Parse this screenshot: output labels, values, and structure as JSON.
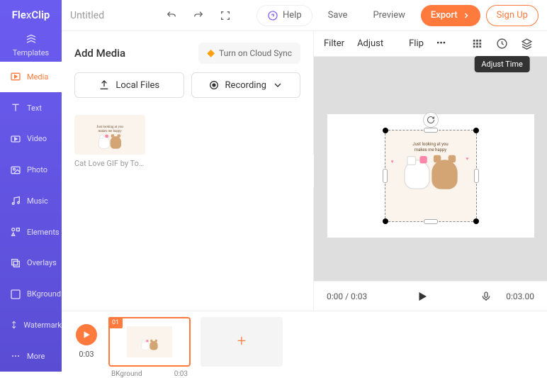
{
  "logo": "FlexClip",
  "sidebar": {
    "items": [
      {
        "label": "Templates"
      },
      {
        "label": "Media"
      },
      {
        "label": "Text"
      },
      {
        "label": "Video"
      },
      {
        "label": "Photo"
      },
      {
        "label": "Music"
      },
      {
        "label": "Elements"
      },
      {
        "label": "Overlays"
      },
      {
        "label": "BKground"
      },
      {
        "label": "Watermark"
      },
      {
        "label": "More"
      }
    ]
  },
  "topbar": {
    "title": "Untitled",
    "help": "Help",
    "save": "Save",
    "preview": "Preview",
    "export": "Export",
    "signup": "Sign Up"
  },
  "panel": {
    "title": "Add Media",
    "cloud_sync": "Turn on Cloud Sync",
    "local_files": "Local Files",
    "recording": "Recording"
  },
  "media": {
    "items": [
      {
        "label": "Cat Love GIF by Tonton ..."
      }
    ]
  },
  "preview_toolbar": {
    "filter": "Filter",
    "adjust": "Adjust",
    "flip": "Flip",
    "tooltip_adjust_time": "Adjust Time"
  },
  "gif": {
    "line1": "Just looking at you",
    "line2": "makes me happy"
  },
  "playback": {
    "current": "0:00",
    "total": "0:03",
    "separator": " / ",
    "duration": "0:03.00"
  },
  "timeline": {
    "play_time": "0:03",
    "clip_badge": "01",
    "clip_name": "BKground",
    "clip_time": "0:03",
    "add": "+"
  }
}
